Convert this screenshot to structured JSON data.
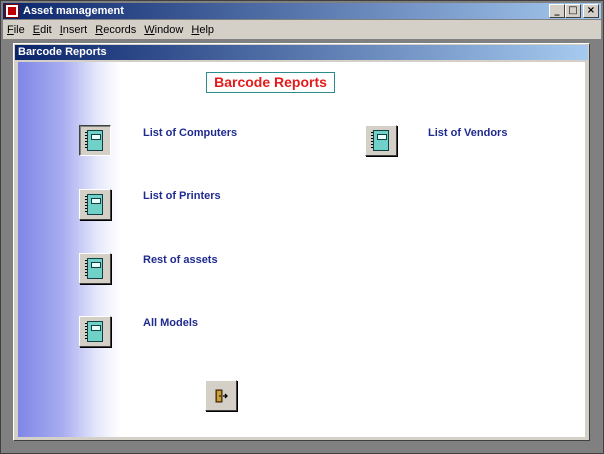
{
  "app": {
    "title": "Asset management"
  },
  "caption_buttons": {
    "minimize": "_",
    "restore": "□",
    "close": "×"
  },
  "menu": [
    {
      "key": "F",
      "rest": "ile"
    },
    {
      "key": "E",
      "rest": "dit"
    },
    {
      "key": "I",
      "rest": "nsert"
    },
    {
      "key": "R",
      "rest": "ecords"
    },
    {
      "key": "W",
      "rest": "indow"
    },
    {
      "key": "H",
      "rest": "elp"
    }
  ],
  "form": {
    "title": "Barcode Reports",
    "heading": "Barcode Reports",
    "reports": [
      {
        "label": "List of Computers",
        "icon": "report-book-icon"
      },
      {
        "label": "List of Printers",
        "icon": "report-book-icon"
      },
      {
        "label": "Rest of assets",
        "icon": "report-book-icon"
      },
      {
        "label": "All Models",
        "icon": "report-book-icon"
      },
      {
        "label": "List of Vendors",
        "icon": "report-book-icon"
      }
    ],
    "exit_icon": "exit-door-icon"
  },
  "colors": {
    "titlebar_start": "#0a246a",
    "titlebar_end": "#a6caf0",
    "heading_text": "#e31b1b",
    "label_text": "#1f2b8f"
  }
}
